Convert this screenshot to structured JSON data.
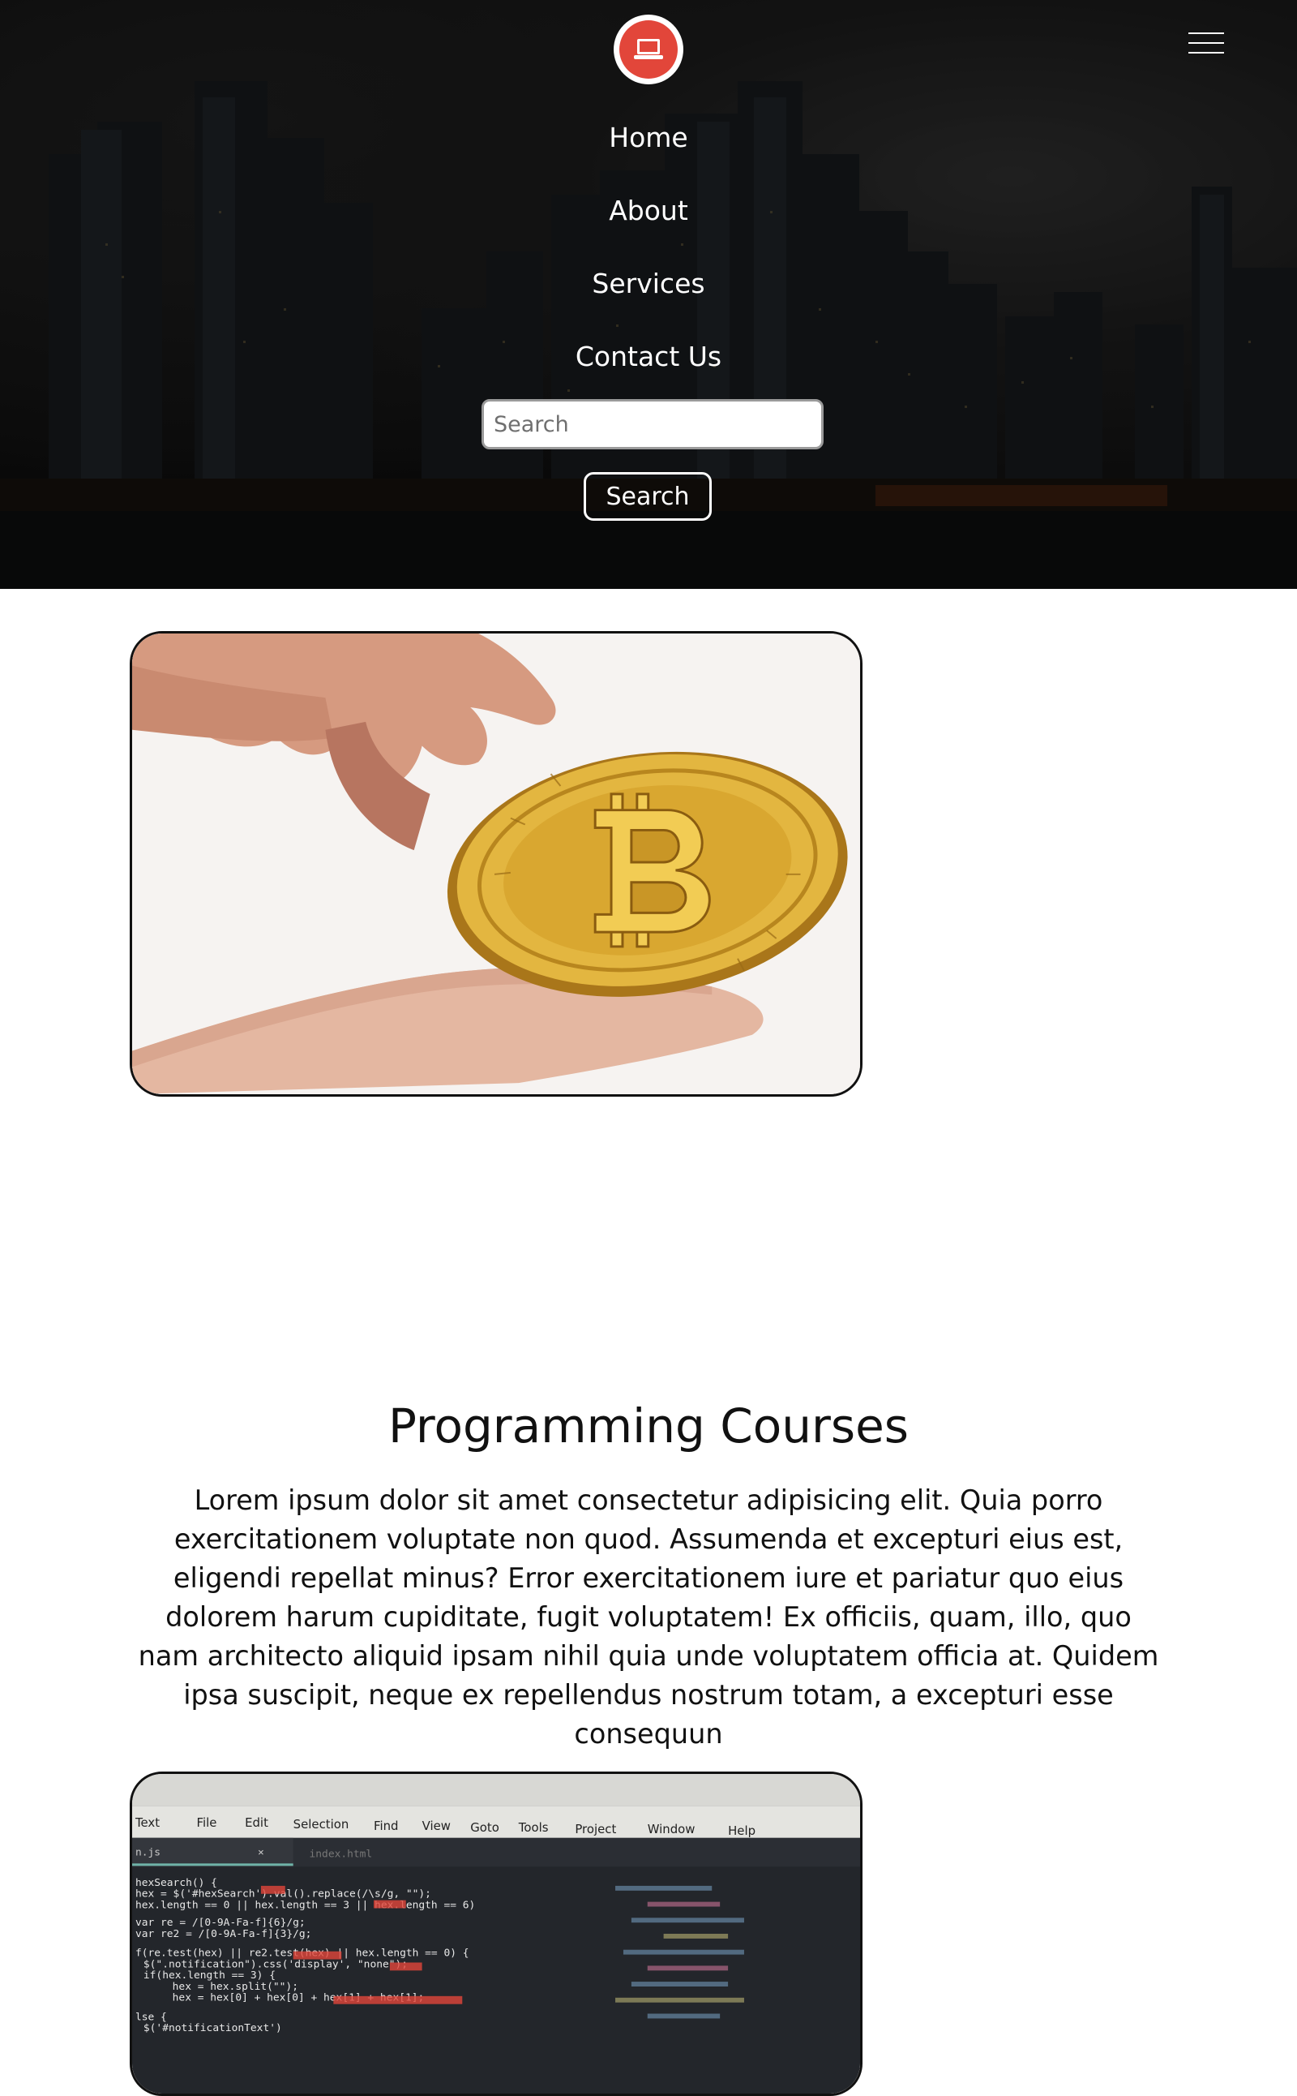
{
  "header": {
    "logo_icon": "laptop-icon",
    "menu_icon": "hamburger-menu-icon",
    "nav": [
      {
        "label": "Home"
      },
      {
        "label": "About"
      },
      {
        "label": "Services"
      },
      {
        "label": "Contact Us"
      }
    ],
    "search": {
      "placeholder": "Search",
      "value": "",
      "button_label": "Search"
    },
    "colors": {
      "logo_accent": "#e2463a",
      "text": "#ffffff"
    }
  },
  "main": {
    "cards": [
      {
        "image": "hand-holding-bitcoin-image"
      },
      {
        "image": "code-editor-screen-image"
      }
    ],
    "section": {
      "title": "Programming Courses",
      "body": "Lorem ipsum dolor sit amet consectetur adipisicing elit. Quia porro exercitationem voluptate non quod. Assumenda et excepturi eius est, eligendi repellat minus? Error exercitationem iure et pariatur quo eius dolorem harum cupiditate, fugit voluptatem! Ex officiis, quam, illo, quo nam architecto aliquid ipsam nihil quia unde voluptatem officia at. Quidem ipsa suscipit, neque ex repellendus nostrum totam, a excepturi esse consequun"
    }
  }
}
